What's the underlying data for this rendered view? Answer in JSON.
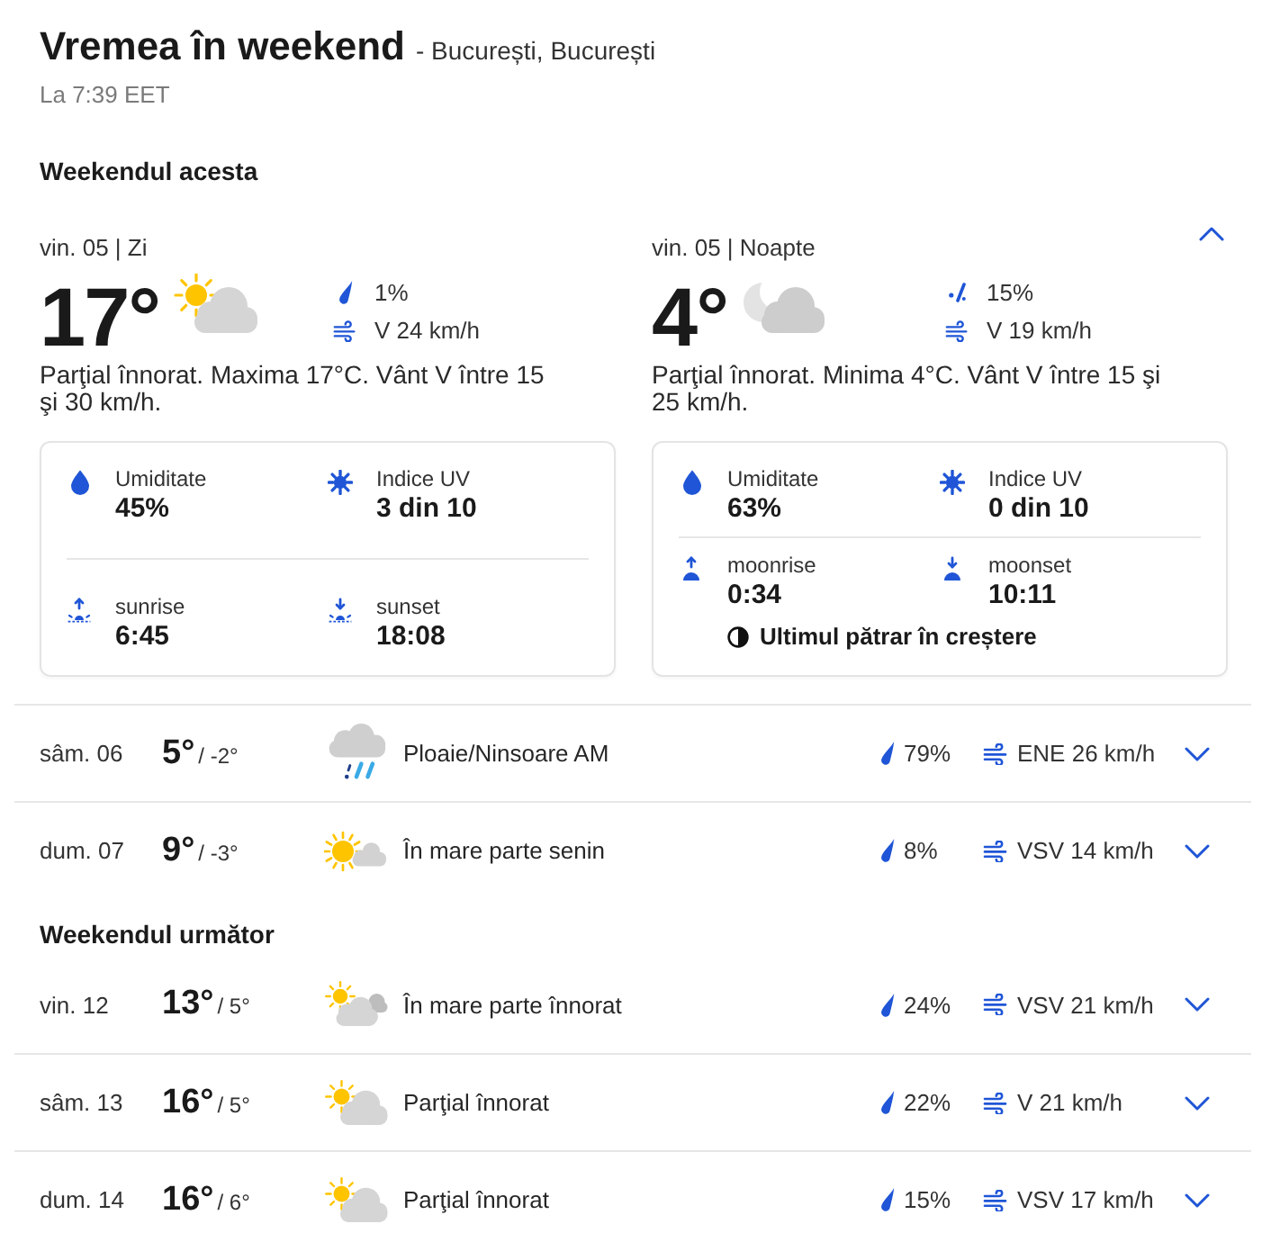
{
  "header": {
    "title": "Vremea în weekend",
    "location": "- București, București",
    "updated": "La 7:39 EET"
  },
  "sections": [
    {
      "title": "Weekendul acesta",
      "days": [
        {
          "kind": "detail",
          "expanded": true,
          "panels": [
            {
              "label": "vin. 05 | Zi",
              "temperature": "17°",
              "condition": {
                "kind": "partly-cloudy-day"
              },
              "precipitation": {
                "kind": "rain",
                "value": "1%"
              },
              "wind": "V 24 km/h",
              "summary": "Parţial înnorat. Maxima 17°C. Vânt V între 15 şi 30 km/h.",
              "details": [
                {
                  "kind": "humidity",
                  "label": "Umiditate",
                  "value": "45%"
                },
                {
                  "kind": "uv",
                  "label": "Indice UV",
                  "value": "3 din 10"
                },
                {
                  "kind": "sunrise",
                  "label": "sunrise",
                  "value": "6:45"
                },
                {
                  "kind": "sunset",
                  "label": "sunset",
                  "value": "18:08"
                }
              ]
            },
            {
              "label": "vin. 05 | Noapte",
              "temperature": "4°",
              "condition": {
                "kind": "partly-cloudy-night"
              },
              "precipitation": {
                "kind": "drizzle",
                "value": "15%"
              },
              "wind": "V 19 km/h",
              "summary": "Parţial înnorat. Minima 4°C. Vânt V între 15 şi 25 km/h.",
              "details": [
                {
                  "kind": "humidity",
                  "label": "Umiditate",
                  "value": "63%"
                },
                {
                  "kind": "uv",
                  "label": "Indice UV",
                  "value": "0 din 10"
                },
                {
                  "kind": "moonrise",
                  "label": "moonrise",
                  "value": "0:34"
                },
                {
                  "kind": "moonset",
                  "label": "moonset",
                  "value": "10:11"
                }
              ],
              "moon_phase": "Ultimul pătrar în creștere"
            }
          ]
        },
        {
          "kind": "summary",
          "expanded": false,
          "date": "sâm. 06",
          "high": "5°",
          "low": "/ -2°",
          "condition": {
            "kind": "rain-snow",
            "text": "Ploaie/Ninsoare AM"
          },
          "precipitation": "79%",
          "wind": "ENE 26 km/h"
        },
        {
          "kind": "summary",
          "expanded": false,
          "date": "dum. 07",
          "high": "9°",
          "low": "/ -3°",
          "condition": {
            "kind": "mostly-sunny",
            "text": "În mare parte senin"
          },
          "precipitation": "8%",
          "wind": "VSV 14 km/h"
        }
      ]
    },
    {
      "title": "Weekendul următor",
      "days": [
        {
          "kind": "summary",
          "expanded": false,
          "date": "vin. 12",
          "high": "13°",
          "low": "/ 5°",
          "condition": {
            "kind": "mostly-cloudy",
            "text": "În mare parte înnorat"
          },
          "precipitation": "24%",
          "wind": "VSV 21 km/h"
        },
        {
          "kind": "summary",
          "expanded": false,
          "date": "sâm. 13",
          "high": "16°",
          "low": "/ 5°",
          "condition": {
            "kind": "partly-cloudy-day",
            "text": "Parţial înnorat"
          },
          "precipitation": "22%",
          "wind": "V 21 km/h"
        },
        {
          "kind": "summary",
          "expanded": false,
          "date": "dum. 14",
          "high": "16°",
          "low": "/ 6°",
          "condition": {
            "kind": "partly-cloudy-day",
            "text": "Parţial înnorat"
          },
          "precipitation": "15%",
          "wind": "VSV 17 km/h"
        }
      ]
    }
  ]
}
